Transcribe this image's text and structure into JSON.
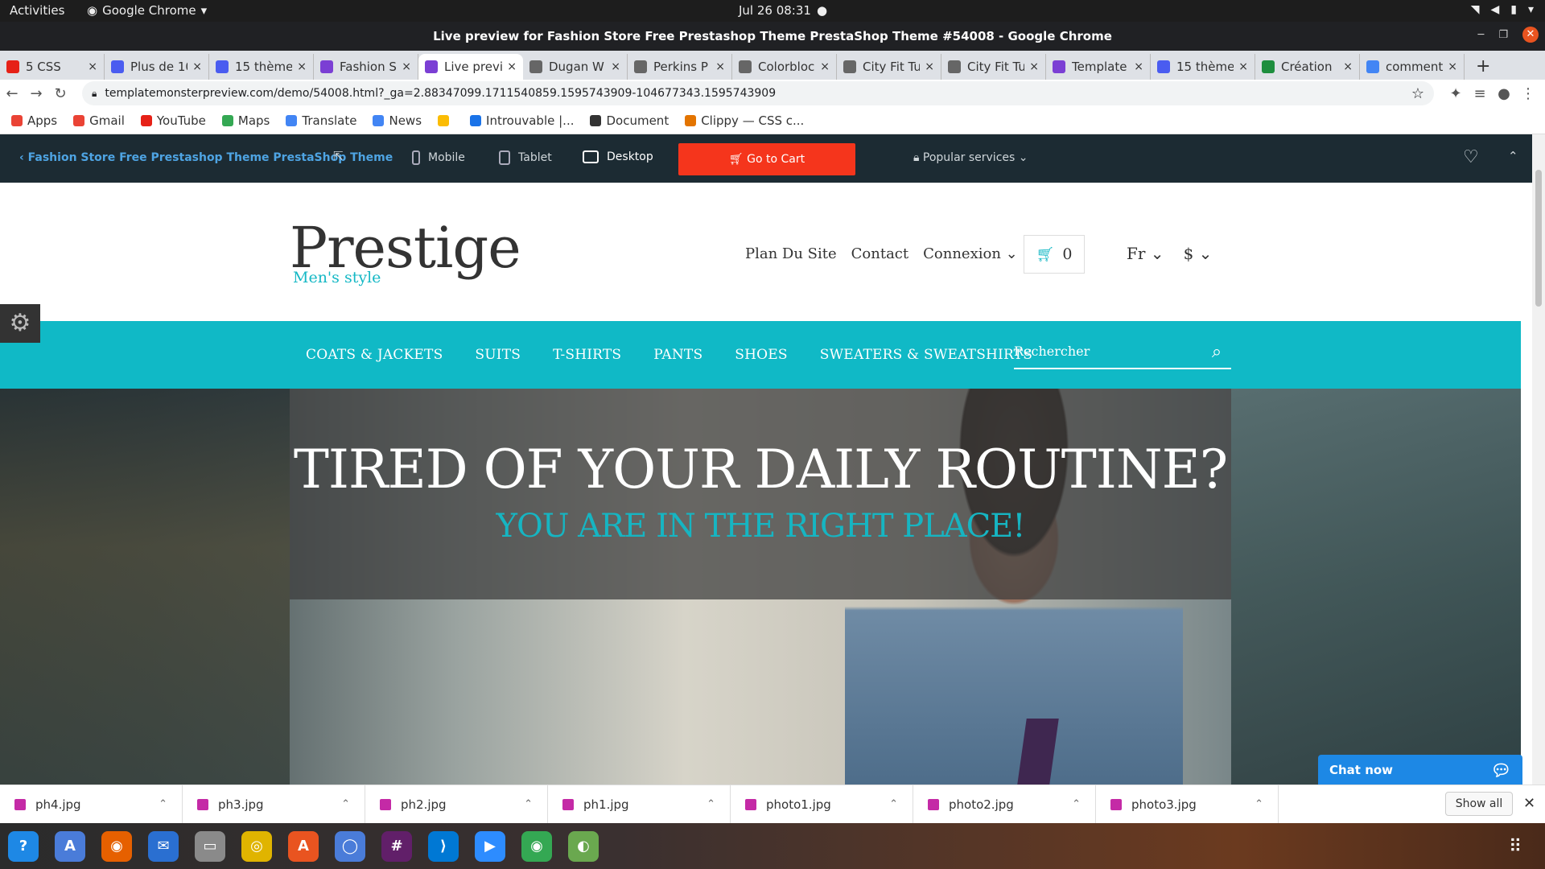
{
  "gnome": {
    "activities": "Activities",
    "app": "Google Chrome",
    "clock": "Jul 26  08:31"
  },
  "window": {
    "title": "Live preview for Fashion Store Free Prestashop Theme PrestaShop Theme #54008 - Google Chrome"
  },
  "tabs": [
    {
      "label": "5 CSS",
      "color": "#e62117"
    },
    {
      "label": "Plus de 10",
      "color": "#4a5cf0"
    },
    {
      "label": "15 thème",
      "color": "#4a5cf0"
    },
    {
      "label": "Fashion S",
      "color": "#7b3fd4"
    },
    {
      "label": "Live previ",
      "color": "#7b3fd4"
    },
    {
      "label": "Dugan W",
      "color": "#666666"
    },
    {
      "label": "Perkins P",
      "color": "#666666"
    },
    {
      "label": "Colorbloc",
      "color": "#666666"
    },
    {
      "label": "City Fit Tu",
      "color": "#666666"
    },
    {
      "label": "City Fit Tu",
      "color": "#666666"
    },
    {
      "label": "Template",
      "color": "#7b3fd4"
    },
    {
      "label": "15 thème",
      "color": "#4a5cf0"
    },
    {
      "label": "Création",
      "color": "#1e8e3e"
    },
    {
      "label": "comment",
      "color": "#4285f4"
    }
  ],
  "tab_close": "×",
  "new_tab": "+",
  "url": "templatemonsterpreview.com/demo/54008.html?_ga=2.88347099.1711540859.1595743909-104677343.1595743909",
  "bookmarks": [
    {
      "label": "Apps",
      "color": "#ea4335"
    },
    {
      "label": "Gmail",
      "color": "#ea4335"
    },
    {
      "label": "YouTube",
      "color": "#e62117"
    },
    {
      "label": "Maps",
      "color": "#34a853"
    },
    {
      "label": "Translate",
      "color": "#4285f4"
    },
    {
      "label": "News",
      "color": "#4285f4"
    },
    {
      "label": "",
      "color": "#fbbc04"
    },
    {
      "label": "Introuvable |...",
      "color": "#1a73e8"
    },
    {
      "label": "Document",
      "color": "#333333"
    },
    {
      "label": "Clippy — CSS c...",
      "color": "#e37400"
    }
  ],
  "tm": {
    "back": "Fashion Store Free Prestashop Theme PrestaShop Theme",
    "mobile": "Mobile",
    "tablet": "Tablet",
    "desktop": "Desktop",
    "cart": "Go to Cart",
    "popular": "Popular services"
  },
  "site": {
    "logo": "Prestige",
    "tagline": "Men's style",
    "nav": [
      "Plan Du Site",
      "Contact",
      "Connexion ⌄"
    ],
    "cart_count": "0",
    "lang": "Fr ⌄",
    "currency": "$ ⌄",
    "categories": [
      "COATS & JACKETS",
      "SUITS",
      "T-SHIRTS",
      "PANTS",
      "SHOES",
      "SWEATERS & SWEATSHIRTS"
    ],
    "search_placeholder": "Rechercher",
    "hero_title": "TIRED OF YOUR DAILY ROUTINE?",
    "hero_sub": "YOU ARE IN THE RIGHT PLACE!",
    "accent": "#10b9c6"
  },
  "chat": "Chat now",
  "downloads": [
    "ph4.jpg",
    "ph3.jpg",
    "ph2.jpg",
    "ph1.jpg",
    "photo1.jpg",
    "photo2.jpg",
    "photo3.jpg"
  ],
  "show_all": "Show all",
  "dock": [
    {
      "name": "help-icon",
      "color": "#1e88e5",
      "glyph": "?"
    },
    {
      "name": "translate-icon",
      "color": "#4a7cd9",
      "glyph": "A"
    },
    {
      "name": "firefox-icon",
      "color": "#e66000",
      "glyph": "◉"
    },
    {
      "name": "thunderbird-icon",
      "color": "#2a6fd1",
      "glyph": "✉"
    },
    {
      "name": "files-icon",
      "color": "#8a8a8a",
      "glyph": "▭"
    },
    {
      "name": "rhythmbox-icon",
      "color": "#e0b400",
      "glyph": "◎"
    },
    {
      "name": "software-icon",
      "color": "#e95420",
      "glyph": "A"
    },
    {
      "name": "chromium-icon",
      "color": "#4a7cd9",
      "glyph": "◯"
    },
    {
      "name": "slack-icon",
      "color": "#611f69",
      "glyph": "#"
    },
    {
      "name": "vscode-icon",
      "color": "#0078d4",
      "glyph": "⟩"
    },
    {
      "name": "zoom-icon",
      "color": "#2d8cff",
      "glyph": "▶"
    },
    {
      "name": "chrome-icon",
      "color": "#34a853",
      "glyph": "◉"
    },
    {
      "name": "network-icon",
      "color": "#6aa84f",
      "glyph": "◐"
    }
  ]
}
